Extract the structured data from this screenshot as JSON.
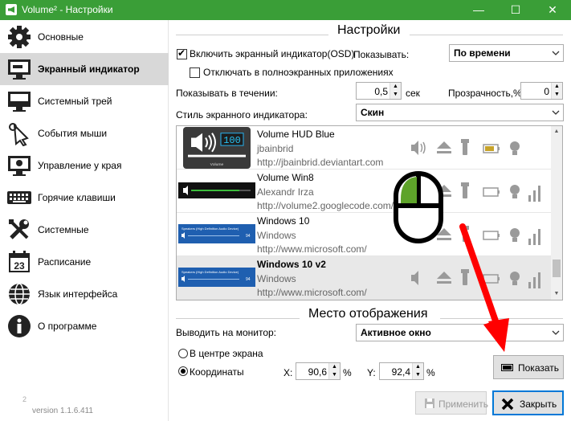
{
  "window": {
    "title": "Volume² - Настройки",
    "min": "—",
    "max": "☐",
    "close": "✕"
  },
  "sidebar": {
    "items": [
      {
        "label": "Основные",
        "icon": "gear-icon"
      },
      {
        "label": "Экранный индикатор",
        "icon": "monitor-icon",
        "active": true
      },
      {
        "label": "Системный трей",
        "icon": "tray-icon"
      },
      {
        "label": "События мыши",
        "icon": "mouse-icon"
      },
      {
        "label": "Управление у края",
        "icon": "screen-edge-icon"
      },
      {
        "label": "Горячие клавиши",
        "icon": "keyboard-icon"
      },
      {
        "label": "Системные",
        "icon": "tools-icon"
      },
      {
        "label": "Расписание",
        "icon": "calendar-icon"
      },
      {
        "label": "Язык интерфейса",
        "icon": "globe-icon"
      },
      {
        "label": "О программе",
        "icon": "info-icon"
      }
    ],
    "calendar_day": "23",
    "logo_mark": "2",
    "version": "version 1.1.6.411"
  },
  "settings": {
    "title": "Настройки",
    "enable_osd": {
      "label": "Включить экранный индикатор(OSD)",
      "checked": true
    },
    "disable_fullscreen": {
      "label": "Отключать в полноэкранных приложениях",
      "checked": false
    },
    "show_label": "Показывать:",
    "show_value": "По времени",
    "duration_label": "Показывать в течении:",
    "duration_value": "0,5",
    "duration_unit": "сек",
    "transparency_label": "Прозрачность,%:",
    "transparency_value": "0",
    "style_label": "Стиль экранного индикатора:",
    "style_value": "Скин",
    "skins": [
      {
        "name": "Volume HUD Blue",
        "author": "jbainbrid",
        "url": "http://jbainbrid.deviantart.com",
        "preview_text": "100",
        "preview_caption": "Volume"
      },
      {
        "name": "Volume Win8",
        "author": "Alexandr Irza",
        "url": "http://volume2.googlecode.com/"
      },
      {
        "name": "Windows 10",
        "author": "Windows",
        "url": "http://www.microsoft.com/",
        "preview_text": "Speakers (High Definition Audio Device)",
        "preview_value": "94"
      },
      {
        "name": "Windows 10 v2",
        "author": "Windows",
        "url": "http://www.microsoft.com/",
        "preview_text": "Speakers (High Definition Audio Device)",
        "preview_value": "94",
        "selected": true
      }
    ]
  },
  "placement": {
    "title": "Место отображения",
    "monitor_label": "Выводить на монитор:",
    "monitor_value": "Активное окно",
    "center_label": "В центре экрана",
    "coords_label": "Координаты",
    "mode": "coordinates",
    "x_label": "X:",
    "x_value": "90,6",
    "y_label": "Y:",
    "y_value": "92,4",
    "unit": "%",
    "show_button": "Показать"
  },
  "footer": {
    "apply": "Применить",
    "close": "Закрыть"
  },
  "colors": {
    "titlebar": "#3a9e37",
    "accent": "#0078d7",
    "annotation_arrow": "#ff0000"
  }
}
